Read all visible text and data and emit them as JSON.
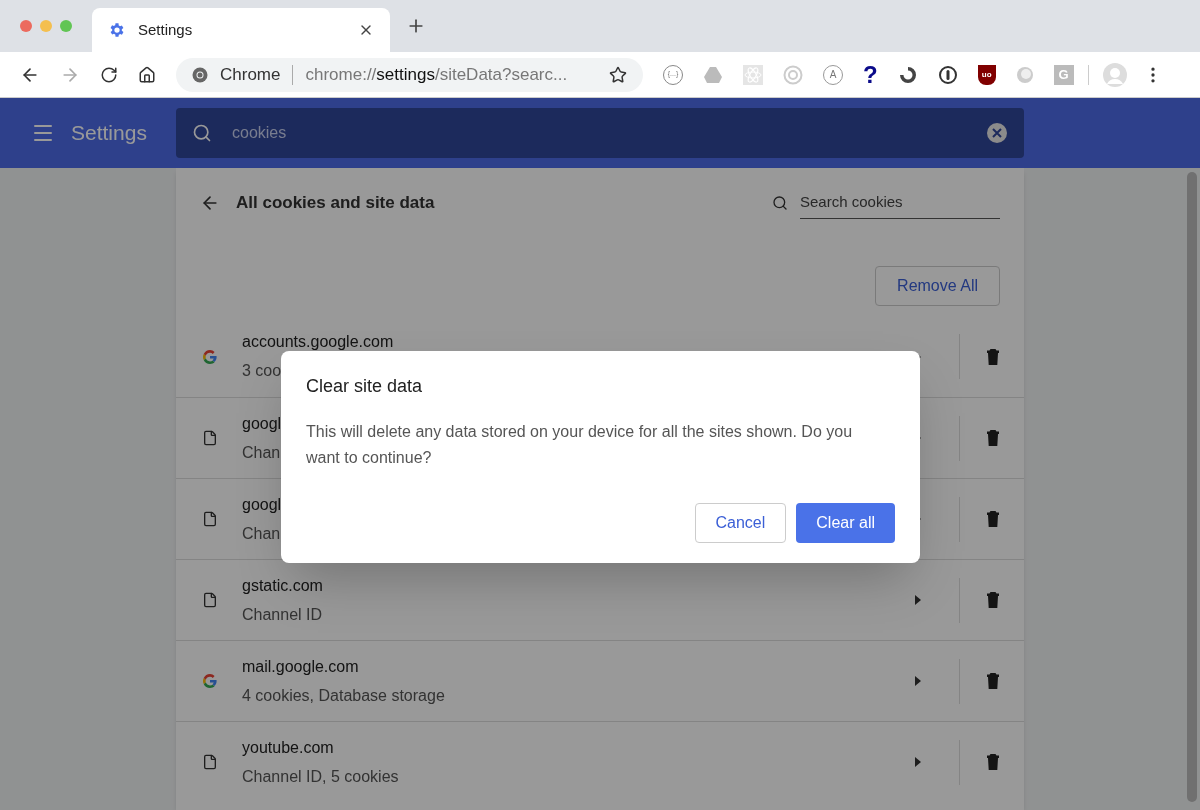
{
  "tab": {
    "title": "Settings",
    "selected": true
  },
  "address_bar": {
    "scheme_label": "Chrome",
    "url_prefix": "chrome://",
    "url_host": "settings",
    "url_rest": "/siteData?searc..."
  },
  "extensions": [
    {
      "kind": "braces",
      "glyph": "{...}"
    },
    {
      "kind": "drive"
    },
    {
      "kind": "atom"
    },
    {
      "kind": "target"
    },
    {
      "kind": "letter",
      "glyph": "A"
    },
    {
      "kind": "question",
      "glyph": "?"
    },
    {
      "kind": "ring"
    },
    {
      "kind": "keyhole"
    },
    {
      "kind": "shield",
      "glyph": "uo"
    },
    {
      "kind": "orb"
    },
    {
      "kind": "square",
      "glyph": "G"
    }
  ],
  "header": {
    "title": "Settings",
    "search": {
      "value": "cookies"
    }
  },
  "page": {
    "title": "All cookies and site data",
    "search": {
      "placeholder": "Search cookies"
    },
    "remove_all": "Remove All",
    "sites": [
      {
        "kind": "google",
        "name": "accounts.google.com",
        "detail": "3 coo"
      },
      {
        "kind": "file",
        "name": "googl",
        "detail": "Chan"
      },
      {
        "kind": "file",
        "name": "googl",
        "detail": "Chan"
      },
      {
        "kind": "file",
        "name": "gstatic.com",
        "detail": "Channel ID"
      },
      {
        "kind": "google",
        "name": "mail.google.com",
        "detail": "4 cookies, Database storage"
      },
      {
        "kind": "file",
        "name": "youtube.com",
        "detail": "Channel ID, 5 cookies"
      }
    ]
  },
  "dialog": {
    "title": "Clear site data",
    "message": "This will delete any data stored on your device for all the sites shown. Do you want to continue?",
    "buttons": [
      {
        "label": "Cancel",
        "kind": "secondary"
      },
      {
        "label": "Clear all",
        "kind": "primary"
      }
    ]
  }
}
